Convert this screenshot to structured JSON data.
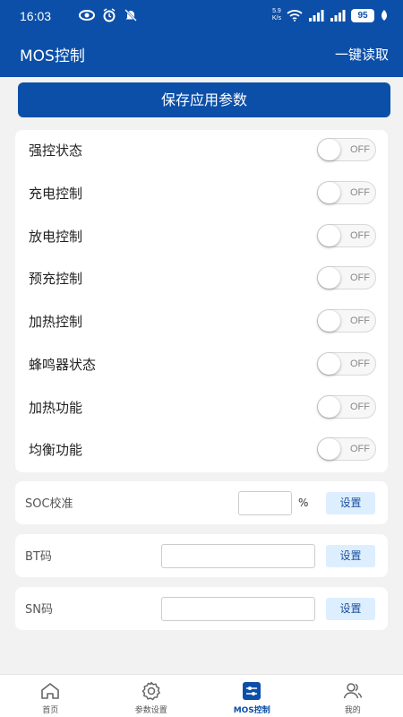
{
  "status_bar": {
    "time": "16:03",
    "net_speed_value": "5.9",
    "net_speed_unit": "K/s",
    "battery": "95"
  },
  "header": {
    "title": "MOS控制",
    "read_all_label": "一键读取"
  },
  "save_button": {
    "label": "保存应用参数"
  },
  "toggles": [
    {
      "label": "强控状态",
      "state": "OFF"
    },
    {
      "label": "充电控制",
      "state": "OFF"
    },
    {
      "label": "放电控制",
      "state": "OFF"
    },
    {
      "label": "预充控制",
      "state": "OFF"
    },
    {
      "label": "加热控制",
      "state": "OFF"
    },
    {
      "label": "蜂鸣器状态",
      "state": "OFF"
    },
    {
      "label": "加热功能",
      "state": "OFF"
    },
    {
      "label": "均衡功能",
      "state": "OFF"
    }
  ],
  "settings": {
    "soc": {
      "label": "SOC校准",
      "value": "",
      "unit": "%",
      "button": "设置"
    },
    "bt": {
      "label": "BT码",
      "value": "",
      "button": "设置"
    },
    "sn": {
      "label": "SN码",
      "value": "",
      "button": "设置"
    }
  },
  "nav": [
    {
      "label": "首页",
      "icon": "home-icon"
    },
    {
      "label": "参数设置",
      "icon": "gear-icon"
    },
    {
      "label": "MOS控制",
      "icon": "sliders-icon"
    },
    {
      "label": "我的",
      "icon": "user-icon"
    }
  ],
  "colors": {
    "primary": "#0c4fa8",
    "button_light": "#ddeeff",
    "background": "#f2f2f2"
  }
}
